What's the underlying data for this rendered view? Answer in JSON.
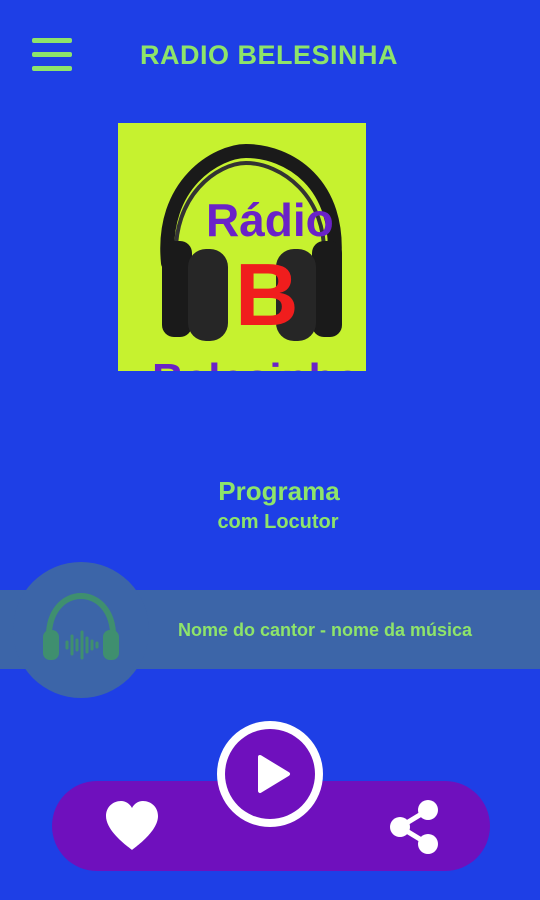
{
  "header": {
    "title": "RADIO BELESINHA",
    "menu_icon": "hamburger-menu-icon"
  },
  "logo": {
    "word": "Rádio",
    "letter": "B",
    "word2": "Belesinha",
    "background": "#c6f22f"
  },
  "program": {
    "name": "Programa",
    "host": "com Locutor"
  },
  "now_playing": {
    "track": "Nome do cantor - nome da música",
    "icon": "headphones-icon"
  },
  "controls": {
    "favorite_icon": "heart-icon",
    "play_icon": "play-icon",
    "share_icon": "share-icon"
  },
  "colors": {
    "background": "#1e3fe6",
    "accent": "#8ee46a",
    "bar": "#6f10bd",
    "now_playing_bar": "#3c65a8"
  }
}
